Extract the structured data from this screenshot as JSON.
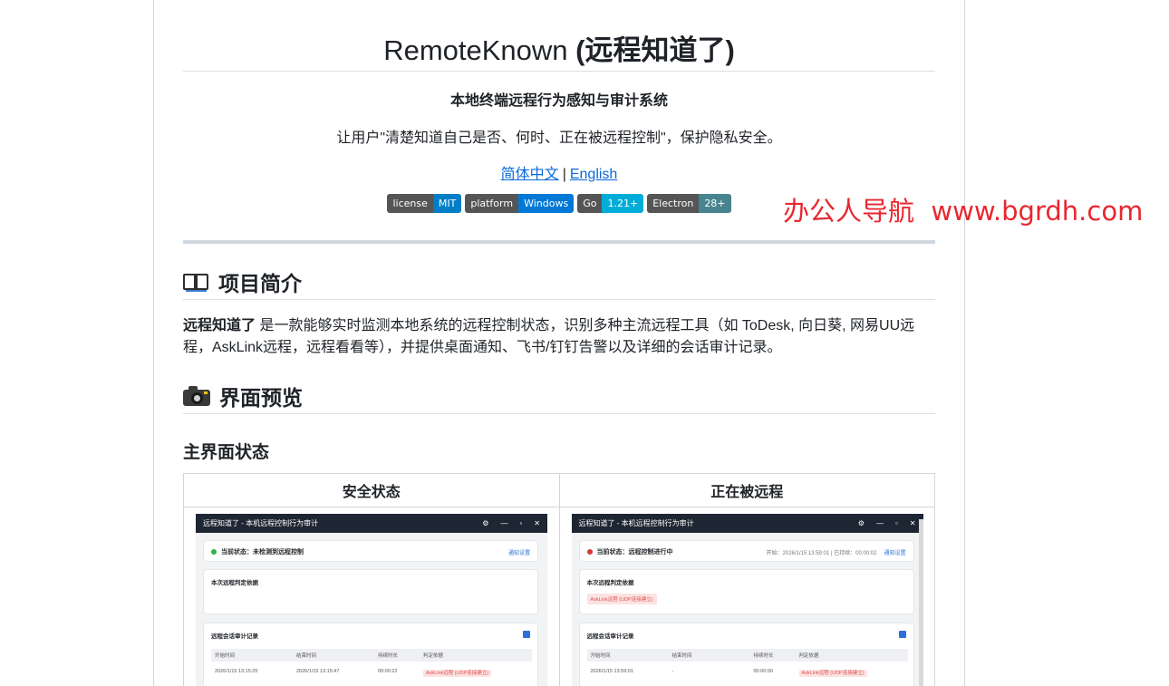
{
  "title": {
    "name": "RemoteKnown",
    "cn": "(远程知道了)"
  },
  "subtitle": "本地终端远程行为感知与审计系统",
  "tagline": "让用户\"清楚知道自己是否、何时、正在被远程控制\"，保护隐私安全。",
  "languages": {
    "zh": "简体中文",
    "sep": "|",
    "en": "English"
  },
  "badges": [
    {
      "key": "license",
      "value": "MIT",
      "color": "#007ec6"
    },
    {
      "key": "platform",
      "value": "Windows",
      "color": "#0078d6"
    },
    {
      "key": "Go",
      "value": "1.21+",
      "color": "#00add8"
    },
    {
      "key": "Electron",
      "value": "28+",
      "color": "#47848f"
    }
  ],
  "intro": {
    "heading": "项目简介",
    "heading_icon": "book-icon",
    "bold": "远程知道了",
    "text": " 是一款能够实时监测本地系统的远程控制状态，识别多种主流远程工具（如 ToDesk, 向日葵, 网易UU远程，AskLink远程，远程看看等），并提供桌面通知、飞书/钉钉告警以及详细的会话审计记录。"
  },
  "preview": {
    "heading": "界面预览",
    "heading_icon": "camera-icon",
    "subheading": "主界面状态",
    "columns": [
      "安全状态",
      "正在被远程"
    ],
    "safe": {
      "window_title": "远程知道了 - 本机远程控制行为审计",
      "status": "当前状态：未检测到远程控制",
      "notify": "通知设置",
      "evidence_title": "本次远程判定依据",
      "audit_title": "远程会话审计记录",
      "table_head": [
        "开始时间",
        "结束时间",
        "持续时长",
        "判定依据"
      ],
      "row": [
        "2026/1/15 13:15:25",
        "2026/1/15 13:15:47",
        "00:00:22",
        "AskLink远程 (UDP连接建立)"
      ]
    },
    "remote": {
      "window_title": "远程知道了 - 本机远程控制行为审计",
      "status": "当前状态：远程控制进行中",
      "meta": "开始：2026/1/15 13:59:01 | 已持续：00:00:02",
      "notify": "通知设置",
      "evidence_title": "本次远程判定依据",
      "evidence_tag": "AskLink远程 (UDP连接建立)",
      "audit_title": "远程会话审计记录",
      "table_head": [
        "开始时间",
        "结束时间",
        "持续时长",
        "判定依据"
      ],
      "row": [
        "2026/1/15 13:59:01",
        "-",
        "00:00:00",
        "AskLink远程 (UDP连接建立)"
      ]
    }
  },
  "watermark": "办公人导航  www.bgrdh.com"
}
